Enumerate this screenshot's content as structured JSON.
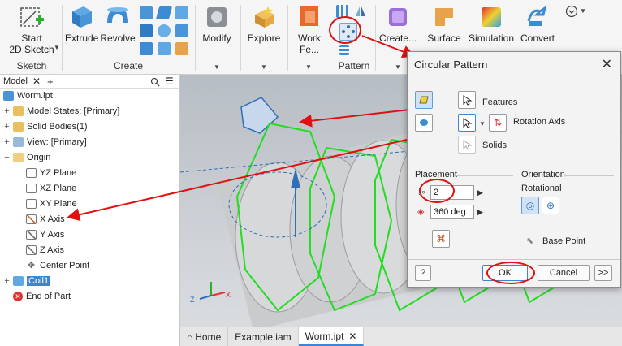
{
  "ribbon": {
    "sketch_panel": {
      "button": "Start\n2D Sketch",
      "title": "Sketch"
    },
    "create_panel": {
      "buttons": [
        "Extrude",
        "Revolve"
      ],
      "title": "Create"
    },
    "modify": "Modify",
    "explore": "Explore",
    "work_features": "Work Fe...",
    "pattern_panel": {
      "title": "Pattern"
    },
    "create_freeform": "Create...",
    "surface": "Surface",
    "simulation": "Simulation",
    "convert": "Convert"
  },
  "browser": {
    "tab_label": "Model",
    "items": [
      {
        "label": "Worm.ipt"
      },
      {
        "label": "Model States: [Primary]"
      },
      {
        "label": "Solid Bodies(1)"
      },
      {
        "label": "View: [Primary]"
      },
      {
        "label": "Origin"
      },
      {
        "label": "YZ Plane"
      },
      {
        "label": "XZ Plane"
      },
      {
        "label": "XY Plane"
      },
      {
        "label": "X Axis"
      },
      {
        "label": "Y Axis"
      },
      {
        "label": "Z Axis"
      },
      {
        "label": "Center Point"
      },
      {
        "label": "Coil1"
      },
      {
        "label": "End of Part"
      }
    ]
  },
  "document_tabs": [
    {
      "label": "Home"
    },
    {
      "label": "Example.iam"
    },
    {
      "label": "Worm.ipt"
    }
  ],
  "dialog": {
    "title": "Circular Pattern",
    "features_label": "Features",
    "rotation_axis_label": "Rotation Axis",
    "solids_label": "Solids",
    "placement_title": "Placement",
    "count_value": "2",
    "angle_value": "360 deg",
    "orientation_title": "Orientation",
    "rotational_label": "Rotational",
    "base_point_label": "Base Point",
    "ok_label": "OK",
    "cancel_label": "Cancel",
    "more_label": ">>",
    "help_label": "?"
  },
  "colors": {
    "accent_blue": "#3a86d4",
    "annotation_red": "#e01010",
    "pattern_green": "#22dd22"
  }
}
